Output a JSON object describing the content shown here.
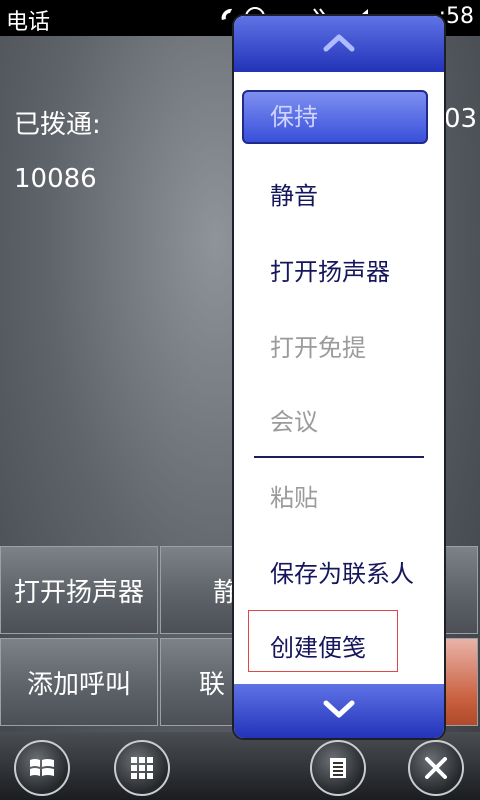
{
  "status_bar": {
    "title": "电话",
    "time": ":58",
    "icons": [
      "phone-icon",
      "connectivity-icon",
      "network-icon",
      "volume-icon"
    ]
  },
  "call": {
    "state_label": "已拨通:",
    "number": "10086",
    "timer_partial": "03"
  },
  "grid_buttons": {
    "row1": [
      "打开扬声器",
      "静"
    ],
    "row2": [
      "添加呼叫",
      "联"
    ]
  },
  "bottom_bar": {
    "icons": [
      "windows-start-icon",
      "keypad-grid-icon",
      "menu-list-icon",
      "close-icon"
    ]
  },
  "menu": {
    "items": [
      {
        "label": "保持",
        "state": "selected"
      },
      {
        "label": "静音",
        "state": "enabled"
      },
      {
        "label": "打开扬声器",
        "state": "enabled"
      },
      {
        "label": "打开免提",
        "state": "disabled"
      },
      {
        "label": "会议",
        "state": "disabled"
      },
      {
        "label": "粘贴",
        "state": "disabled"
      },
      {
        "label": "保存为联系人",
        "state": "enabled"
      },
      {
        "label": "创建便笺",
        "state": "enabled"
      }
    ]
  },
  "colors": {
    "menu_header": "#2e43c7",
    "menu_text": "#16165c",
    "menu_disabled_text": "#9b9b9b",
    "highlight_border": "#e04848"
  }
}
